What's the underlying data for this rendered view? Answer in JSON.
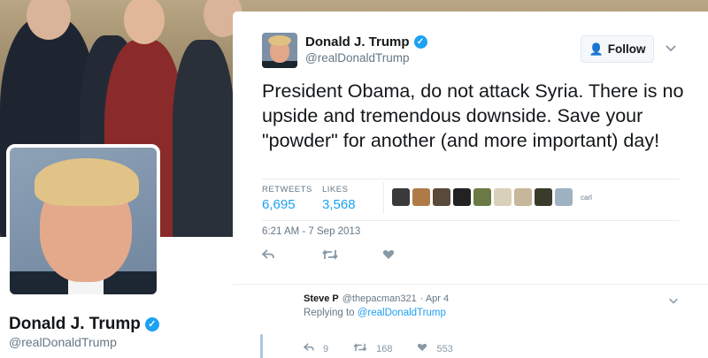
{
  "background": {
    "name": "Donald J. Trump",
    "handle": "@realDonaldTrump"
  },
  "tweet": {
    "author_name": "Donald J. Trump",
    "author_handle": "@realDonaldTrump",
    "follow_label": "Follow",
    "text": "President Obama, do not attack Syria. There is no upside and tremendous downside. Save your \"powder\" for another (and more important) day!",
    "retweets_label": "RETWEETS",
    "retweets_count": "6,695",
    "likes_label": "LIKES",
    "likes_count": "3,568",
    "liker_name": "carl",
    "timestamp": "6:21 AM - 7 Sep 2013",
    "liker_colors": [
      "#3a3a3a",
      "#b07a48",
      "#5a4a3a",
      "#222222",
      "#6b7a45",
      "#d8d0b8",
      "#c7b79a",
      "#3b3b2b",
      "#9fb2c2"
    ]
  },
  "reply": {
    "name": "Steve P",
    "handle": "@thepacman321",
    "date": "· Apr 4",
    "replying_prefix": "Replying to",
    "replying_to": "@realDonaldTrump",
    "replies": "9",
    "retweets": "168",
    "likes": "553"
  },
  "icons": {
    "reply": "reply-icon",
    "retweet": "retweet-icon",
    "like": "heart-icon",
    "verified": "verified-badge-icon",
    "follow": "follow-person-icon",
    "more": "chevron-down-icon"
  },
  "colors": {
    "accent": "#1da1f2",
    "muted": "#657786"
  }
}
